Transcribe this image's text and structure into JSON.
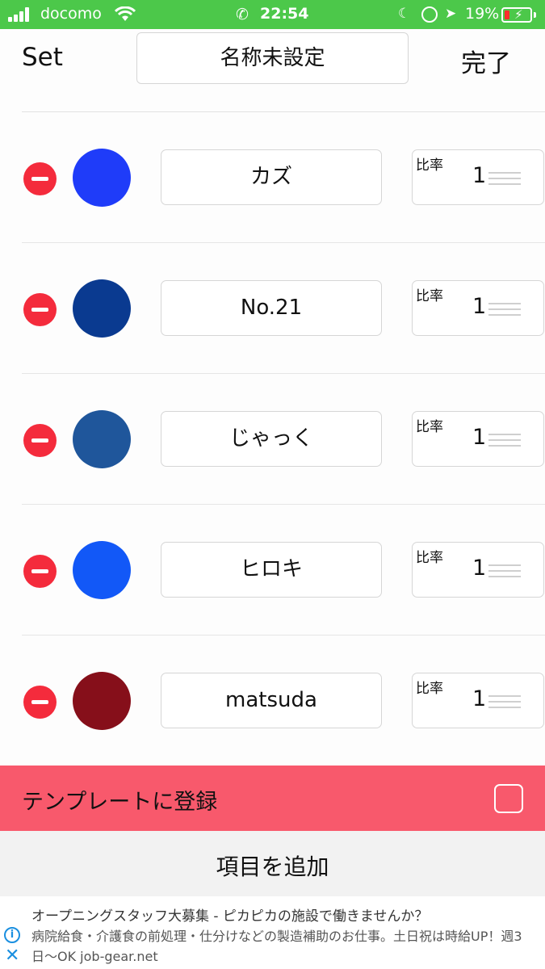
{
  "status_bar": {
    "carrier": "docomo",
    "time": "22:54",
    "battery": "19%"
  },
  "header": {
    "left_label": "Set",
    "title": "名称未設定",
    "done_label": "完了"
  },
  "items": [
    {
      "name": "カズ",
      "ratio_label": "比率",
      "ratio": "1",
      "color": "#1f3cf9"
    },
    {
      "name": "No.21",
      "ratio_label": "比率",
      "ratio": "1",
      "color": "#0a3a90"
    },
    {
      "name": "じゃっく",
      "ratio_label": "比率",
      "ratio": "1",
      "color": "#1f569b"
    },
    {
      "name": "ヒロキ",
      "ratio_label": "比率",
      "ratio": "1",
      "color": "#1258f7"
    },
    {
      "name": "matsuda",
      "ratio_label": "比率",
      "ratio": "1",
      "color": "#860f1a"
    }
  ],
  "template_bar": {
    "label": "テンプレートに登録",
    "color": "#f8596c"
  },
  "add_button": {
    "label": "項目を追加"
  },
  "ad": {
    "title": "オープニングスタッフ大募集 - ピカピカの施設で働きませんか？",
    "body": "病院給食・介護食の前処理・仕分けなどの製造補助のお仕事。土日祝は時給UP！週3日〜OK job-gear.net"
  }
}
